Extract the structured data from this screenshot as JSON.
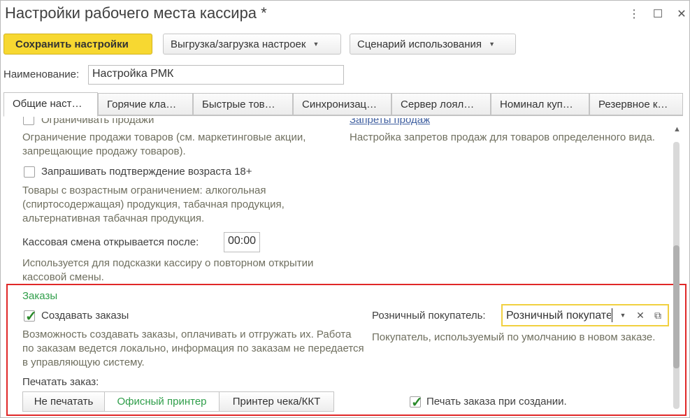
{
  "window": {
    "title": "Настройки рабочего места кассира *",
    "controls": {
      "more": "⋮",
      "maximize": "☐",
      "close": "✕"
    }
  },
  "toolbar": {
    "save_label": "Сохранить настройки",
    "export_import_label": "Выгрузка/загрузка настроек",
    "scenario_label": "Сценарий использования"
  },
  "name_field": {
    "label": "Наименование:",
    "value": "Настройка РМК"
  },
  "tabs": [
    {
      "label": "Общие наст…"
    },
    {
      "label": "Горячие кла…"
    },
    {
      "label": "Быстрые тов…"
    },
    {
      "label": "Синхронизац…"
    },
    {
      "label": "Сервер лоял…"
    },
    {
      "label": "Номинал куп…"
    },
    {
      "label": "Резервное к…"
    }
  ],
  "content": {
    "cut_top_left": "Ограничивать продажи",
    "sale_restriction_desc": "Ограничение продажи товаров (см. маркетинговые акции, запрещающие продажу товаров).",
    "sale_bans_link": "Запреты продаж",
    "sale_bans_desc": "Настройка запретов продаж для товаров определенного вида.",
    "age_confirm_label": "Запрашивать подтверждение возраста 18+",
    "age_confirm_checked": false,
    "age_desc": "Товары с возрастным ограничением: алкогольная (спиртосодержащая) продукция, табачная продукция, альтернативная табачная продукция.",
    "shift_label": "Кассовая смена открывается после:",
    "shift_value": "00:00",
    "shift_desc": "Используется для подсказки кассиру о повторном открытии кассовой смены."
  },
  "orders": {
    "section_title": "Заказы",
    "create_orders_label": "Создавать заказы",
    "create_orders_checked": true,
    "create_orders_desc": "Возможность создавать заказы, оплачивать и отгружать их. Работа по заказам ведется локально, информация по заказам не передается в управляющую систему.",
    "retail_buyer_label": "Розничный покупатель:",
    "retail_buyer_value": "Розничный покупатель",
    "retail_buyer_desc": "Покупатель, используемый по умолчанию в новом заказе.",
    "print_order_label": "Печатать заказ:",
    "print_options": [
      "Не печатать",
      "Офисный принтер",
      "Принтер чека/ККТ"
    ],
    "print_selected": "Офисный принтер",
    "print_on_create_label": "Печать заказа при создании.",
    "print_on_create_checked": true
  },
  "colors": {
    "accent_yellow": "#f7d831",
    "section_green": "#2f9e4a",
    "highlight_red": "#e02828",
    "description_text": "#6f6f5f"
  }
}
